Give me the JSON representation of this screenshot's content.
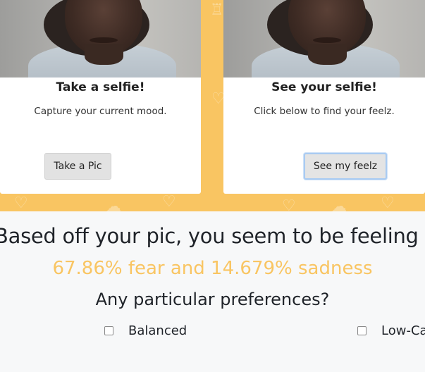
{
  "theme": {
    "accent_yellow": "#f9c562",
    "text_dark": "#1f2329",
    "button_focus_border": "#a9cbf2"
  },
  "cards": {
    "left": {
      "title": "Take a selfie!",
      "text": "Capture your current mood.",
      "button_label": "Take a Pic"
    },
    "right": {
      "title": "See your selfie!",
      "text": "Click below to find your feelz.",
      "button_label": "See my feelz"
    }
  },
  "results": {
    "heading": "Based off your pic, you seem to be feeling",
    "emotion": "67.86% fear and 14.679% sadness",
    "preferences_heading": "Any particular preferences?",
    "options": [
      {
        "label": "Balanced",
        "checked": false
      },
      {
        "label": "Low-Ca",
        "checked": false
      }
    ]
  }
}
